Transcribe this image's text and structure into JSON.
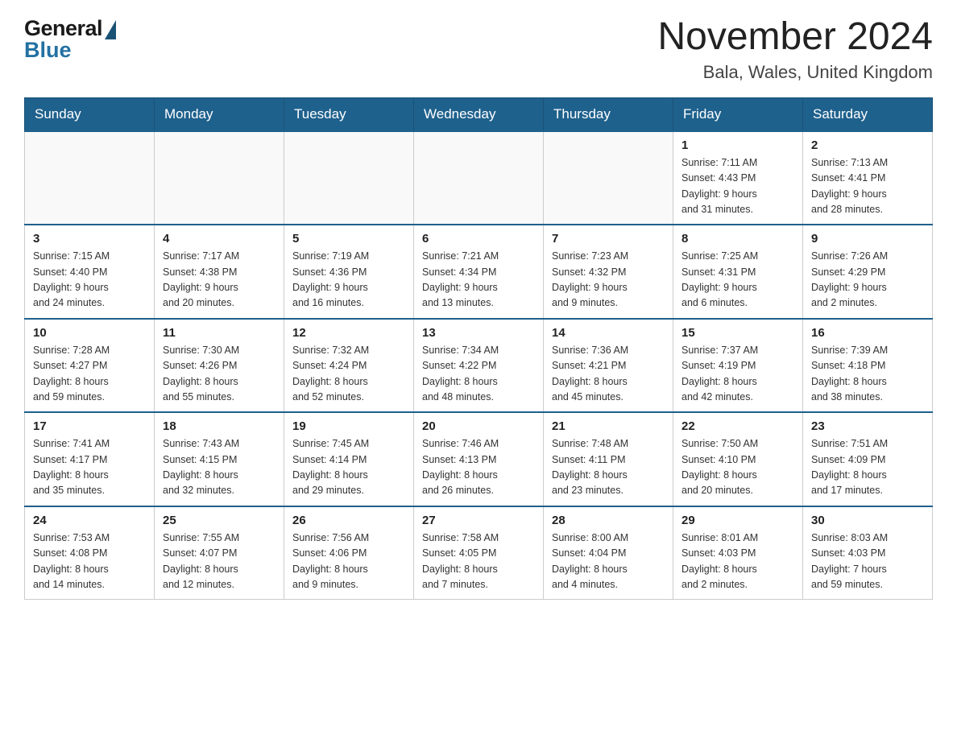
{
  "header": {
    "title": "November 2024",
    "subtitle": "Bala, Wales, United Kingdom",
    "logo_general": "General",
    "logo_blue": "Blue"
  },
  "weekdays": [
    "Sunday",
    "Monday",
    "Tuesday",
    "Wednesday",
    "Thursday",
    "Friday",
    "Saturday"
  ],
  "weeks": [
    {
      "days": [
        {
          "number": "",
          "info": ""
        },
        {
          "number": "",
          "info": ""
        },
        {
          "number": "",
          "info": ""
        },
        {
          "number": "",
          "info": ""
        },
        {
          "number": "",
          "info": ""
        },
        {
          "number": "1",
          "info": "Sunrise: 7:11 AM\nSunset: 4:43 PM\nDaylight: 9 hours\nand 31 minutes."
        },
        {
          "number": "2",
          "info": "Sunrise: 7:13 AM\nSunset: 4:41 PM\nDaylight: 9 hours\nand 28 minutes."
        }
      ]
    },
    {
      "days": [
        {
          "number": "3",
          "info": "Sunrise: 7:15 AM\nSunset: 4:40 PM\nDaylight: 9 hours\nand 24 minutes."
        },
        {
          "number": "4",
          "info": "Sunrise: 7:17 AM\nSunset: 4:38 PM\nDaylight: 9 hours\nand 20 minutes."
        },
        {
          "number": "5",
          "info": "Sunrise: 7:19 AM\nSunset: 4:36 PM\nDaylight: 9 hours\nand 16 minutes."
        },
        {
          "number": "6",
          "info": "Sunrise: 7:21 AM\nSunset: 4:34 PM\nDaylight: 9 hours\nand 13 minutes."
        },
        {
          "number": "7",
          "info": "Sunrise: 7:23 AM\nSunset: 4:32 PM\nDaylight: 9 hours\nand 9 minutes."
        },
        {
          "number": "8",
          "info": "Sunrise: 7:25 AM\nSunset: 4:31 PM\nDaylight: 9 hours\nand 6 minutes."
        },
        {
          "number": "9",
          "info": "Sunrise: 7:26 AM\nSunset: 4:29 PM\nDaylight: 9 hours\nand 2 minutes."
        }
      ]
    },
    {
      "days": [
        {
          "number": "10",
          "info": "Sunrise: 7:28 AM\nSunset: 4:27 PM\nDaylight: 8 hours\nand 59 minutes."
        },
        {
          "number": "11",
          "info": "Sunrise: 7:30 AM\nSunset: 4:26 PM\nDaylight: 8 hours\nand 55 minutes."
        },
        {
          "number": "12",
          "info": "Sunrise: 7:32 AM\nSunset: 4:24 PM\nDaylight: 8 hours\nand 52 minutes."
        },
        {
          "number": "13",
          "info": "Sunrise: 7:34 AM\nSunset: 4:22 PM\nDaylight: 8 hours\nand 48 minutes."
        },
        {
          "number": "14",
          "info": "Sunrise: 7:36 AM\nSunset: 4:21 PM\nDaylight: 8 hours\nand 45 minutes."
        },
        {
          "number": "15",
          "info": "Sunrise: 7:37 AM\nSunset: 4:19 PM\nDaylight: 8 hours\nand 42 minutes."
        },
        {
          "number": "16",
          "info": "Sunrise: 7:39 AM\nSunset: 4:18 PM\nDaylight: 8 hours\nand 38 minutes."
        }
      ]
    },
    {
      "days": [
        {
          "number": "17",
          "info": "Sunrise: 7:41 AM\nSunset: 4:17 PM\nDaylight: 8 hours\nand 35 minutes."
        },
        {
          "number": "18",
          "info": "Sunrise: 7:43 AM\nSunset: 4:15 PM\nDaylight: 8 hours\nand 32 minutes."
        },
        {
          "number": "19",
          "info": "Sunrise: 7:45 AM\nSunset: 4:14 PM\nDaylight: 8 hours\nand 29 minutes."
        },
        {
          "number": "20",
          "info": "Sunrise: 7:46 AM\nSunset: 4:13 PM\nDaylight: 8 hours\nand 26 minutes."
        },
        {
          "number": "21",
          "info": "Sunrise: 7:48 AM\nSunset: 4:11 PM\nDaylight: 8 hours\nand 23 minutes."
        },
        {
          "number": "22",
          "info": "Sunrise: 7:50 AM\nSunset: 4:10 PM\nDaylight: 8 hours\nand 20 minutes."
        },
        {
          "number": "23",
          "info": "Sunrise: 7:51 AM\nSunset: 4:09 PM\nDaylight: 8 hours\nand 17 minutes."
        }
      ]
    },
    {
      "days": [
        {
          "number": "24",
          "info": "Sunrise: 7:53 AM\nSunset: 4:08 PM\nDaylight: 8 hours\nand 14 minutes."
        },
        {
          "number": "25",
          "info": "Sunrise: 7:55 AM\nSunset: 4:07 PM\nDaylight: 8 hours\nand 12 minutes."
        },
        {
          "number": "26",
          "info": "Sunrise: 7:56 AM\nSunset: 4:06 PM\nDaylight: 8 hours\nand 9 minutes."
        },
        {
          "number": "27",
          "info": "Sunrise: 7:58 AM\nSunset: 4:05 PM\nDaylight: 8 hours\nand 7 minutes."
        },
        {
          "number": "28",
          "info": "Sunrise: 8:00 AM\nSunset: 4:04 PM\nDaylight: 8 hours\nand 4 minutes."
        },
        {
          "number": "29",
          "info": "Sunrise: 8:01 AM\nSunset: 4:03 PM\nDaylight: 8 hours\nand 2 minutes."
        },
        {
          "number": "30",
          "info": "Sunrise: 8:03 AM\nSunset: 4:03 PM\nDaylight: 7 hours\nand 59 minutes."
        }
      ]
    }
  ]
}
